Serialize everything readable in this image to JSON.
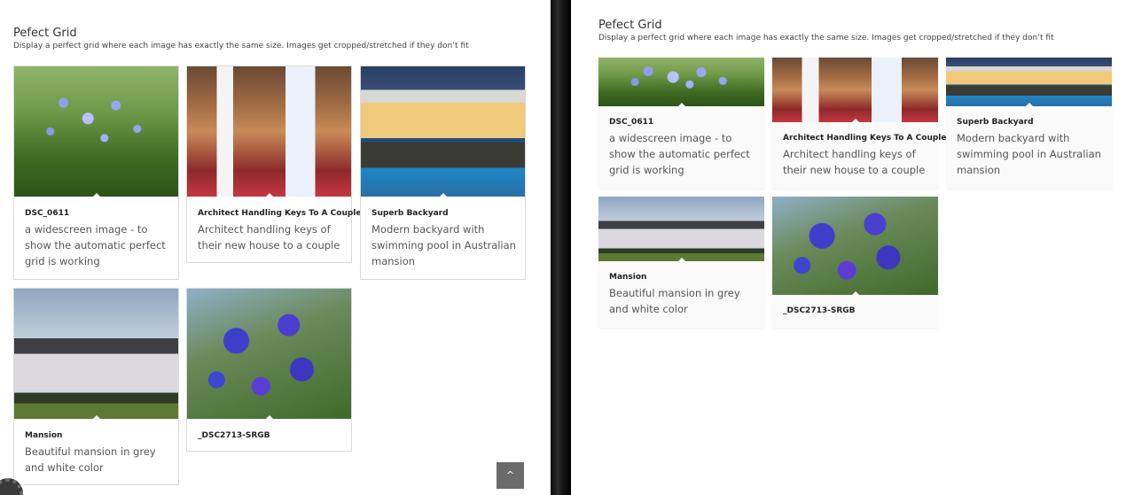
{
  "gallery": {
    "title": "Pefect Grid",
    "subtitle": "Display a perfect grid where each image has exactly the same size. Images get cropped/stretched if they don’t fit",
    "items": [
      {
        "title": "DSC_0611",
        "description": "a widescreen image - to show the automatic perfect grid is working",
        "image": "purple-agapanthus-flower"
      },
      {
        "title": "Architect Handling Keys To A Couple",
        "description": "Architect handling keys of their new house to a couple",
        "image": "architect-giving-keys-photo"
      },
      {
        "title": "Superb Backyard",
        "description": "Modern backyard with swimming pool in Australian mansion",
        "image": "backyard-pool-photo"
      },
      {
        "title": "Mansion",
        "description": "Beautiful mansion in grey and white color",
        "image": "grey-white-mansion-photo"
      },
      {
        "title": "_DSC2713-SRGB",
        "description": "",
        "image": "morning-glory-flowers-photo"
      }
    ]
  },
  "controls": {
    "scroll_top_icon": "chevron-up-icon",
    "scroll_top_glyph": "^",
    "settings_icon": "gear-icon"
  },
  "colors": {
    "divider": "#111111",
    "card_border": "#d9d9d9",
    "scroll_top_bg": "#6b6b6b"
  }
}
